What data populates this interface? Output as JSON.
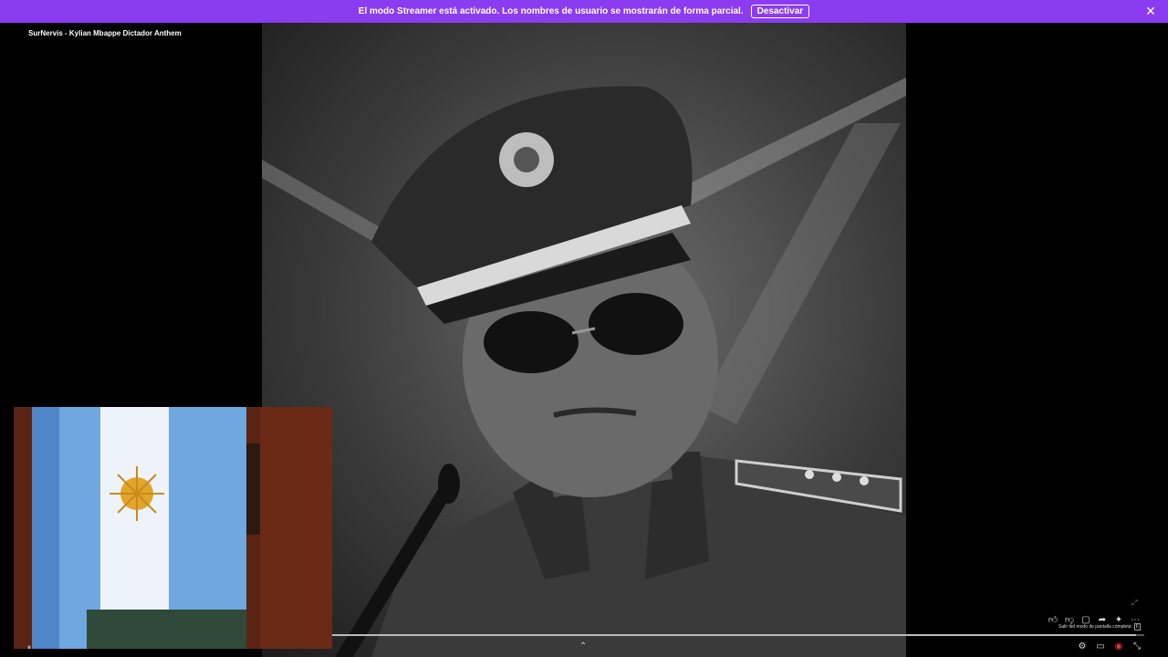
{
  "banner": {
    "message": "El modo Streamer está activado. Los nombres de usuario se mostrarán de forma parcial.",
    "action_label": "Desactivar",
    "close_icon": "close-icon",
    "color": "#8b3cf0"
  },
  "video": {
    "title": "SurNervis - Kylian Mbappe Dictador Anthem",
    "progress": 0.99
  },
  "player": {
    "tooltip_text": "Salir del modo de pantalla completa",
    "tooltip_key": "F",
    "top_icons": [
      "like-icon",
      "dislike-icon",
      "comment-icon",
      "share-icon",
      "sparkle-icon",
      "more-icon"
    ],
    "bottom_icons": [
      "settings-icon",
      "miniplayer-icon",
      "cast-icon",
      "exit-fullscreen-icon"
    ]
  }
}
